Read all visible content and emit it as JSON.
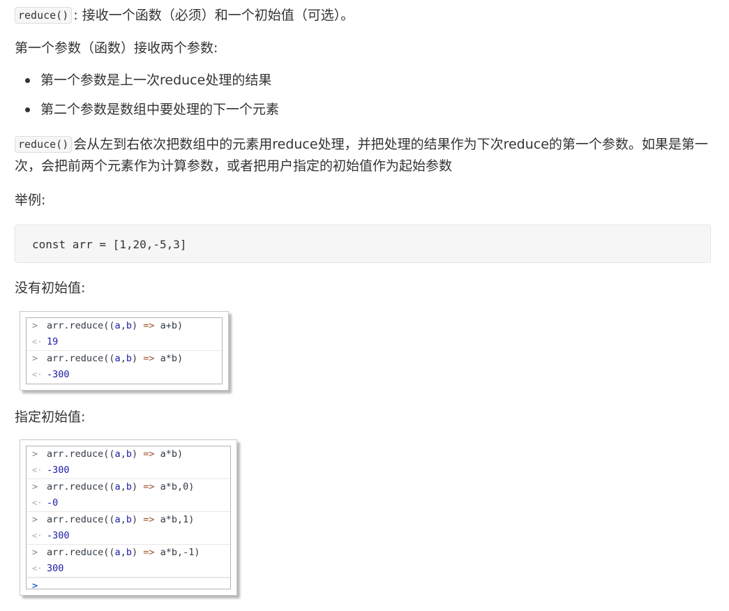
{
  "intro": {
    "code": "reduce()",
    "text": ": 接收一个函数（必须）和一个初始值（可选）。"
  },
  "param_heading": "第一个参数（函数）接收两个参数:",
  "bullets": [
    "第一个参数是上一次reduce处理的结果",
    "第二个参数是数组中要处理的下一个元素"
  ],
  "para2": {
    "code": "reduce()",
    "text": "会从左到右依次把数组中的元素用reduce处理，并把处理的结果作为下次reduce的第一个参数。如果是第一次，会把前两个元素作为计算参数，或者把用户指定的初始值作为起始参数"
  },
  "example_label": "举例:",
  "code_example": "const arr = [1,20,-5,3]",
  "no_init_label": "没有初始值:",
  "console1": [
    {
      "input": {
        "pre": "arr.reduce((",
        "a": "a",
        "c1": ",",
        "b": "b",
        "mid": ") ",
        "arrow": "=>",
        "post": " a+b)"
      },
      "output": "19"
    },
    {
      "input": {
        "pre": "arr.reduce((",
        "a": "a",
        "c1": ",",
        "b": "b",
        "mid": ") ",
        "arrow": "=>",
        "post": " a*b)"
      },
      "output": "-300"
    }
  ],
  "with_init_label": "指定初始值:",
  "console2": [
    {
      "input": {
        "pre": "arr.reduce((",
        "a": "a",
        "c1": ",",
        "b": "b",
        "mid": ") ",
        "arrow": "=>",
        "post": " a*b)"
      },
      "output": "-300"
    },
    {
      "input": {
        "pre": "arr.reduce((",
        "a": "a",
        "c1": ",",
        "b": "b",
        "mid": ") ",
        "arrow": "=>",
        "post": " a*b,0)"
      },
      "output": "-0"
    },
    {
      "input": {
        "pre": "arr.reduce((",
        "a": "a",
        "c1": ",",
        "b": "b",
        "mid": ") ",
        "arrow": "=>",
        "post": " a*b,1)"
      },
      "output": "-300"
    },
    {
      "input": {
        "pre": "arr.reduce((",
        "a": "a",
        "c1": ",",
        "b": "b",
        "mid": ") ",
        "arrow": "=>",
        "post": " a*b,-1)"
      },
      "output": "300"
    }
  ],
  "glyphs": {
    "input": ">",
    "output": "<·",
    "prompt": ">"
  }
}
